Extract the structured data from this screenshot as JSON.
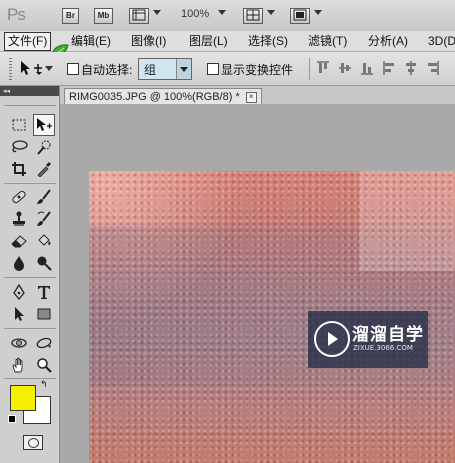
{
  "app": {
    "logo": "Ps",
    "launch_bridge": "Br",
    "mini_bridge": "Mb",
    "zoom": "100%",
    "icons": [
      "bridge-icon",
      "mini-bridge-icon",
      "view-extras-icon",
      "arrange-documents-icon",
      "screen-mode-icon",
      "dropdown-arrow-icon"
    ]
  },
  "menus": [
    {
      "label": "文件(F)"
    },
    {
      "label": "编辑(E)"
    },
    {
      "label": "图像(I)"
    },
    {
      "label": "图层(L)"
    },
    {
      "label": "选择(S)"
    },
    {
      "label": "滤镜(T)"
    },
    {
      "label": "分析(A)"
    },
    {
      "label": "3D(D"
    }
  ],
  "options": {
    "auto_select_label": "自动选择:",
    "auto_select_value": "组",
    "show_transform_label": "显示变换控件",
    "auto_select_checked": false,
    "show_transform_checked": false
  },
  "document": {
    "tab_label": "RIMG0035.JPG @ 100%(RGB/8) *",
    "close_symbol": "×"
  },
  "watermark": {
    "brand": "溜溜自学",
    "url": "ZIXUE.3066.COM"
  },
  "colors": {
    "foreground": "#f5f000",
    "background": "#ffffff"
  },
  "tools": [
    "rectangular-marquee",
    "move",
    "lasso",
    "quick-selection",
    "crop",
    "eyedropper",
    "spot-healing-brush",
    "brush",
    "clone-stamp",
    "history-brush",
    "eraser",
    "paint-bucket",
    "blur",
    "dodge",
    "pen",
    "type",
    "path-selection",
    "rectangle",
    "3d-rotate",
    "3d-orbit",
    "hand",
    "zoom"
  ]
}
